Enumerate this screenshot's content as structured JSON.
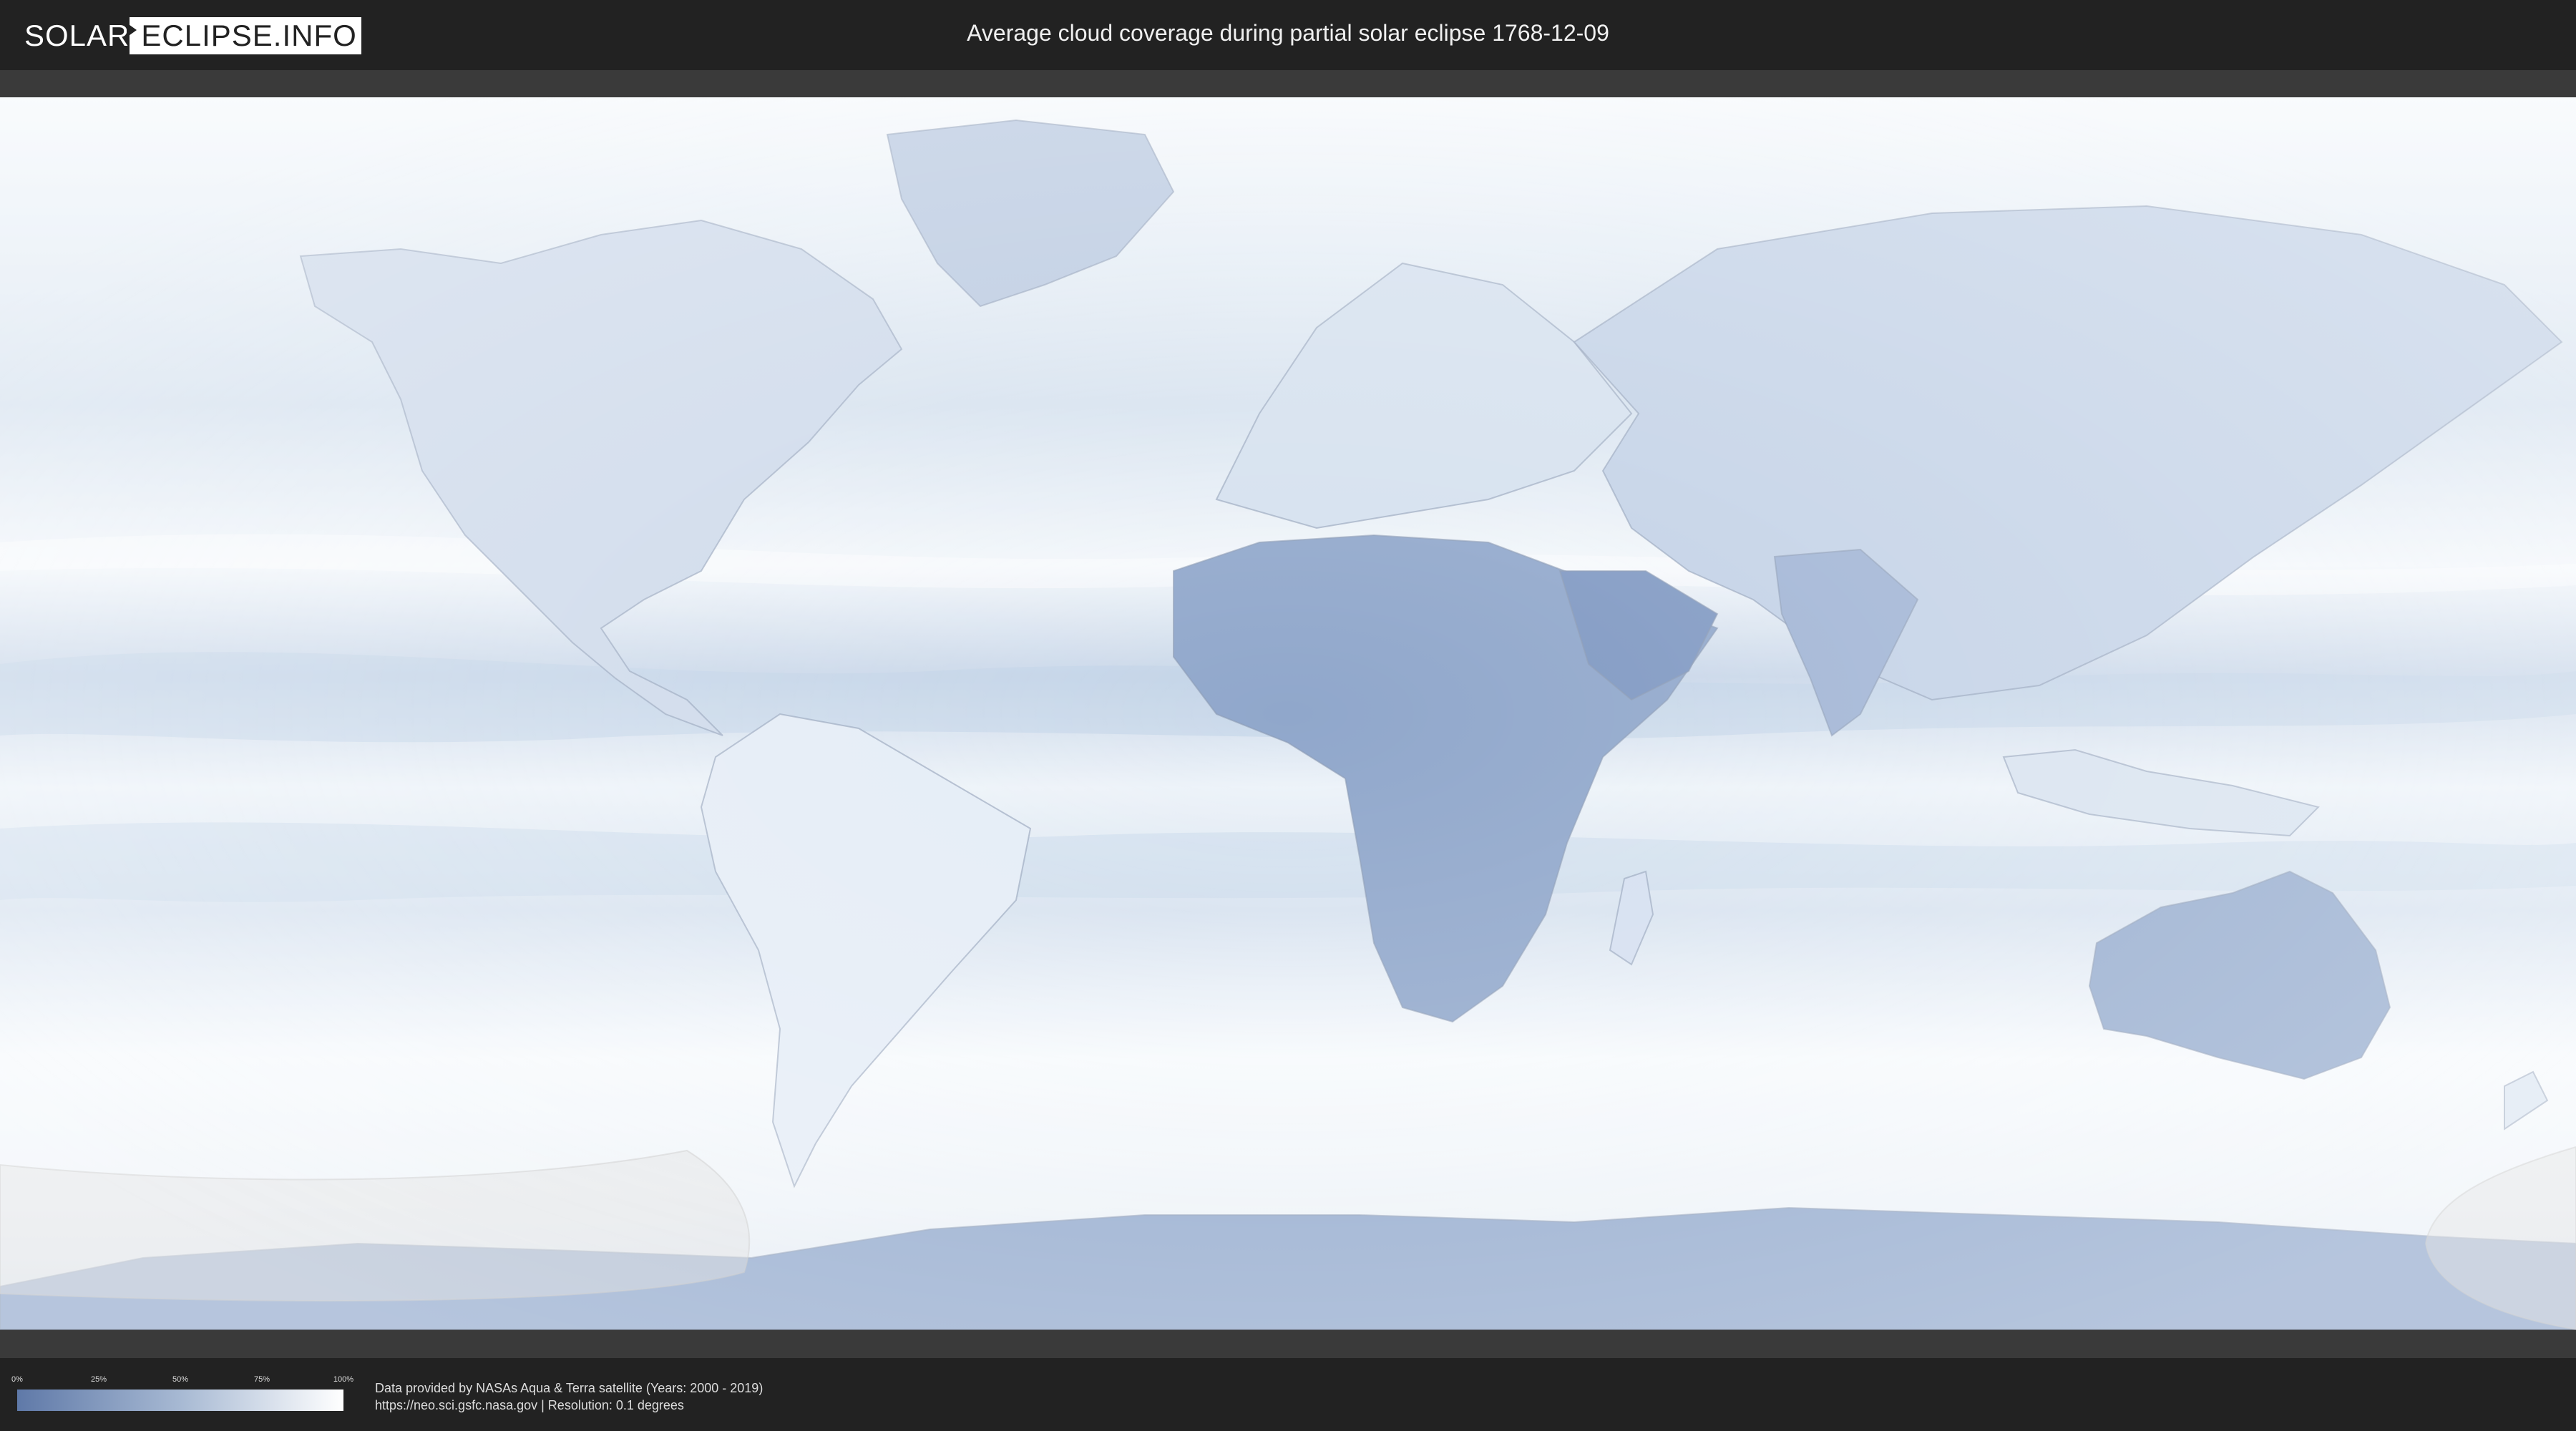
{
  "header": {
    "logo_part1": "SOLAR",
    "logo_part2": "ECLIPSE.INFO",
    "title": "Average cloud coverage during partial solar eclipse 1768-12-09"
  },
  "map": {
    "ocean_color": "#dfe9f4",
    "land_color": "#c7d6e9",
    "dry_color": "#7f98c2",
    "clear_color": "#ffffff",
    "eclipse_region_color": "#d9d9d9"
  },
  "legend": {
    "ticks": [
      "0%",
      "25%",
      "50%",
      "75%",
      "100%"
    ],
    "color_low": "#5f79a8",
    "color_high": "#ffffff"
  },
  "footer": {
    "line1": "Data provided by NASAs Aqua & Terra satellite (Years: 2000 - 2019)",
    "line2": "https://neo.sci.gsfc.nasa.gov | Resolution: 0.1 degrees"
  }
}
